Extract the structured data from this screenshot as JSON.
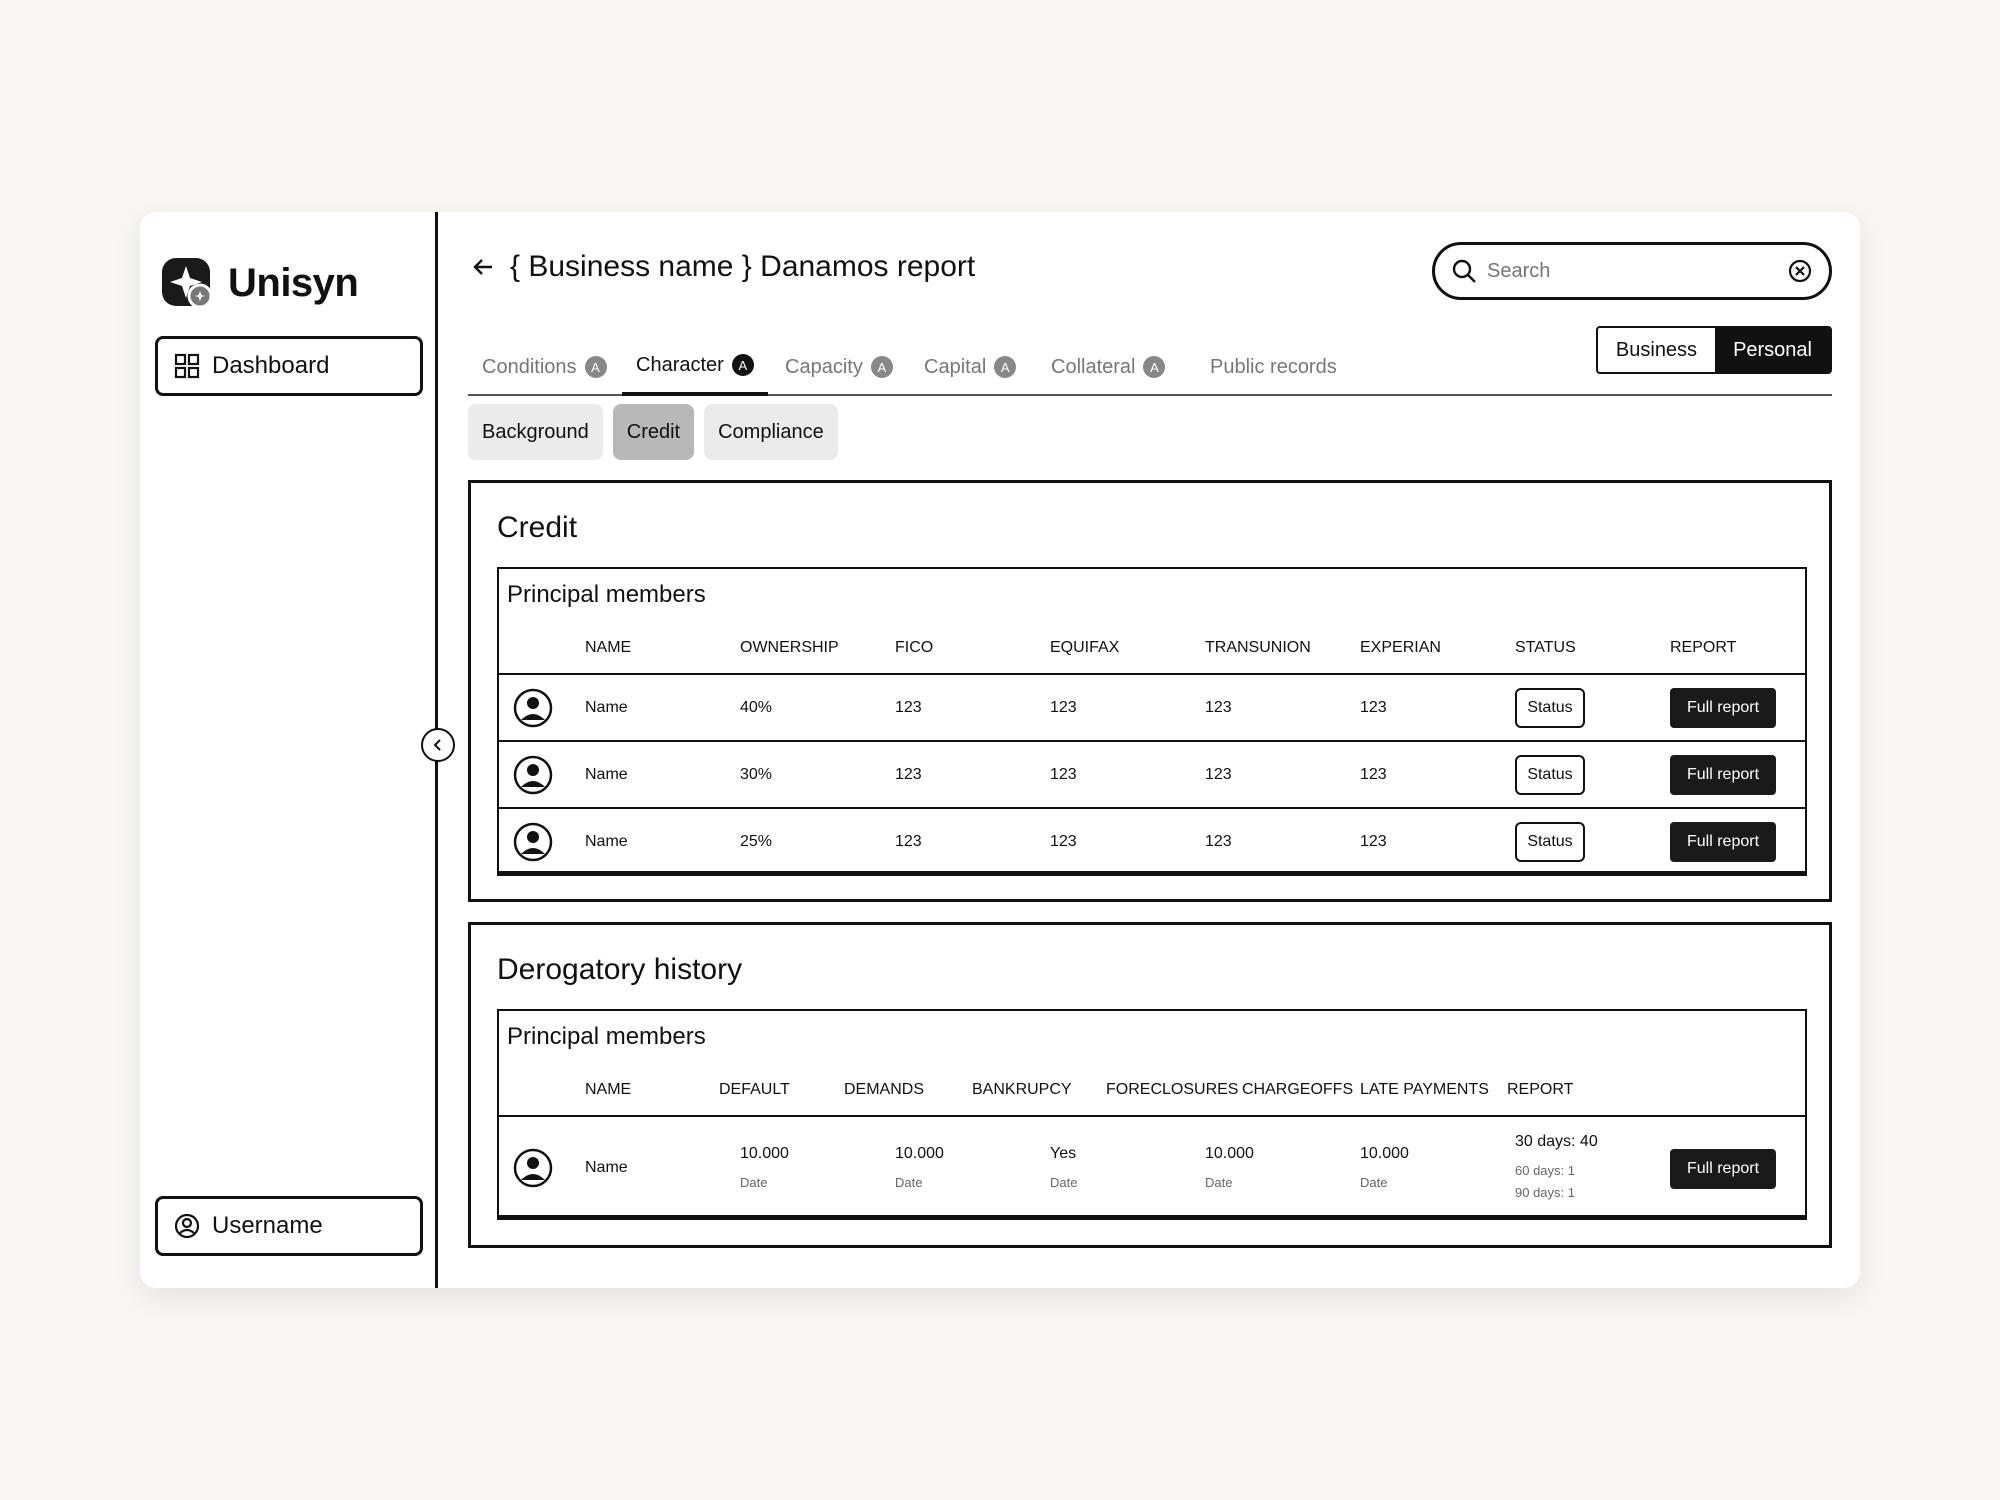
{
  "app": {
    "name": "Unisyn"
  },
  "sidebar": {
    "dashboard_label": "Dashboard",
    "username_label": "Username"
  },
  "header": {
    "title": "{ Business name } Danamos report"
  },
  "search": {
    "placeholder": "Search"
  },
  "tabs": [
    {
      "label": "Conditions",
      "badge": "A"
    },
    {
      "label": "Character",
      "badge": "A"
    },
    {
      "label": "Capacity",
      "badge": "A"
    },
    {
      "label": "Capital",
      "badge": "A"
    },
    {
      "label": "Collateral",
      "badge": "A"
    },
    {
      "label": "Public records"
    }
  ],
  "toggle": {
    "business": "Business",
    "personal": "Personal",
    "selected": "Personal"
  },
  "subtabs": [
    "Background",
    "Credit",
    "Compliance"
  ],
  "credit": {
    "title": "Credit",
    "table_title": "Principal members",
    "headers": [
      "NAME",
      "OWNERSHIP",
      "FICO",
      "EQUIFAX",
      "TRANSUNION",
      "EXPERIAN",
      "STATUS",
      "REPORT"
    ],
    "rows": [
      {
        "name": "Name",
        "ownership": "40%",
        "fico": "123",
        "equifax": "123",
        "transunion": "123",
        "experian": "123",
        "status": "Status",
        "report": "Full report"
      },
      {
        "name": "Name",
        "ownership": "30%",
        "fico": "123",
        "equifax": "123",
        "transunion": "123",
        "experian": "123",
        "status": "Status",
        "report": "Full report"
      },
      {
        "name": "Name",
        "ownership": "25%",
        "fico": "123",
        "equifax": "123",
        "transunion": "123",
        "experian": "123",
        "status": "Status",
        "report": "Full report"
      }
    ]
  },
  "derogatory": {
    "title": "Derogatory history",
    "table_title": "Principal members",
    "headers": [
      "NAME",
      "DEFAULT",
      "DEMANDS",
      "BANKRUPCY",
      "FORECLOSURES",
      "CHARGEOFFS",
      "LATE PAYMENTS",
      "REPORT"
    ],
    "rows": [
      {
        "name": "Name",
        "default": "10.000",
        "default_sub": "Date",
        "demands": "10.000",
        "demands_sub": "Date",
        "bankruptcy": "Yes",
        "bankruptcy_sub": "Date",
        "foreclosures": "10.000",
        "foreclosures_sub": "Date",
        "chargeoffs": "10.000",
        "chargeoffs_sub": "Date",
        "late_main": "30 days: 40",
        "late_60": "60 days: 1",
        "late_90": "90 days: 1",
        "report": "Full report"
      }
    ]
  }
}
